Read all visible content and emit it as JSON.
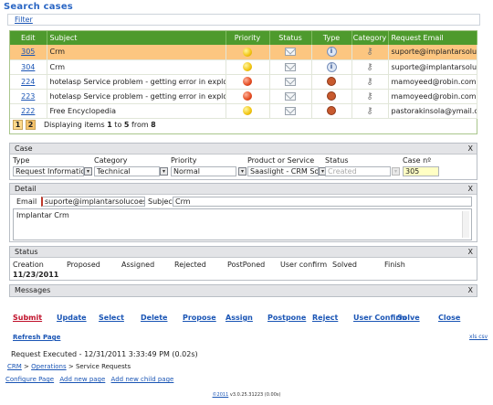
{
  "page": {
    "title": "Search cases",
    "filter_link": "Filter"
  },
  "grid": {
    "columns": [
      "Edit",
      "Subject",
      "Priority",
      "Status",
      "Type",
      "Category",
      "Request Email"
    ],
    "rows": [
      {
        "id": "305",
        "subject": "Crm",
        "priority": "yellow",
        "type": "info",
        "email": "suporte@implantarsolucoes.com",
        "selected": true
      },
      {
        "id": "304",
        "subject": "Crm",
        "priority": "yellow",
        "type": "info",
        "email": "suporte@implantarsolucoes.com",
        "selected": false
      },
      {
        "id": "224",
        "subject": "hotelasp Service problem - getting error in explorer while",
        "priority": "red",
        "type": "bug",
        "email": "mamoyeed@robin.com.sa",
        "selected": false
      },
      {
        "id": "223",
        "subject": "hotelasp Service problem - getting error in explorer while",
        "priority": "red",
        "type": "bug",
        "email": "mamoyeed@robin.com.sa",
        "selected": false
      },
      {
        "id": "222",
        "subject": "Free Encyclopedia",
        "priority": "yellow",
        "type": "bug",
        "email": "pastorakinsola@ymail.com",
        "selected": false
      }
    ],
    "pages": [
      "1",
      "2"
    ],
    "pager_text": {
      "pre": "Displaying items ",
      "from": "1",
      "mid": " to ",
      "to": "5",
      "post": " from ",
      "total": "8"
    }
  },
  "case_panel": {
    "header": "Case",
    "close": "X",
    "labels": {
      "type": "Type",
      "category": "Category",
      "priority": "Priority",
      "product": "Product or Service",
      "status": "Status",
      "case_no": "Case nº"
    },
    "values": {
      "type": "Request Information",
      "category": "Technical",
      "priority": "Normal",
      "product": "Saaslight - CRM Softwa",
      "status": "Created",
      "case_no": "305"
    }
  },
  "detail_panel": {
    "header": "Detail",
    "close": "X",
    "email_label": "Email",
    "email_value": "suporte@implantarsolucoes.com.br",
    "subject_label": "Subject",
    "subject_value": "Crm",
    "body": "Implantar Crm"
  },
  "status_panel": {
    "header": "Status",
    "close": "X",
    "columns": [
      "Creation",
      "Proposed",
      "Assigned",
      "Rejected",
      "PostPoned",
      "User confirm",
      "Solved",
      "Finish"
    ],
    "creation_date": "11/23/2011"
  },
  "messages_panel": {
    "header": "Messages",
    "close": "X"
  },
  "actions": [
    "Submit",
    "Update",
    "Select",
    "Delete",
    "Propose",
    "Assign",
    "Postpone",
    "Reject",
    "User Confirm",
    "Solve",
    "Close"
  ],
  "footer": {
    "refresh": "Refresh Page",
    "export": "xls csv",
    "request_executed": "Request Executed - 12/31/2011 3:33:49 PM (0.02s)",
    "breadcrumb": [
      "CRM",
      "Operations",
      "Service Requests"
    ],
    "breadcrumb_sep": ">",
    "links": [
      "Configure Page",
      "Add new page",
      "Add new child page"
    ],
    "copyright_link": "©2011",
    "version": "v3.0.25.31223 (0.00s)"
  },
  "colors": {
    "grid_header": "#4e9a2d",
    "selected_row": "#fcc680",
    "title": "#2a66c4",
    "submit": "#c0102a"
  }
}
